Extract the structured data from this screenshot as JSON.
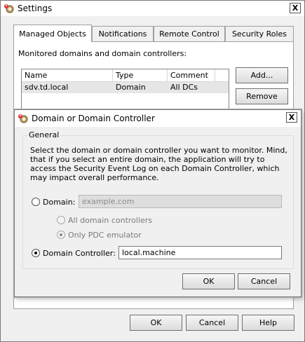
{
  "settings_window": {
    "title": "Settings",
    "close_label": "X",
    "tabs": [
      {
        "label": "Managed Objects",
        "active": true
      },
      {
        "label": "Notifications",
        "active": false
      },
      {
        "label": "Remote Control",
        "active": false
      },
      {
        "label": "Security Roles",
        "active": false
      }
    ],
    "section_label": "Monitored domains and domain controllers:",
    "list": {
      "columns": [
        "Name",
        "Type",
        "Comment"
      ],
      "rows": [
        {
          "name": "sdv.td.local",
          "type": "Domain",
          "comment": "All DCs"
        }
      ]
    },
    "side_buttons": {
      "add": "Add...",
      "remove": "Remove"
    },
    "footer_buttons": {
      "ok": "OK",
      "cancel": "Cancel",
      "help": "Help"
    }
  },
  "dialog": {
    "title": "Domain or Domain Controller",
    "close_label": "X",
    "group_title": "General",
    "description": "Select the domain or domain controller you want to monitor. Mind, that if you select an entire domain, the application will try to access the Security Event Log on each Domain Controller, which may impact overall performance.",
    "domain_label": "Domain:",
    "domain_placeholder": "example.com",
    "domain_value": "",
    "all_dc_label": "All domain controllers",
    "pdc_label": "Only PDC emulator",
    "dc_label": "Domain Controller:",
    "dc_value": "local.machine",
    "selected_option": "domain-controller",
    "ok": "OK",
    "cancel": "Cancel"
  }
}
